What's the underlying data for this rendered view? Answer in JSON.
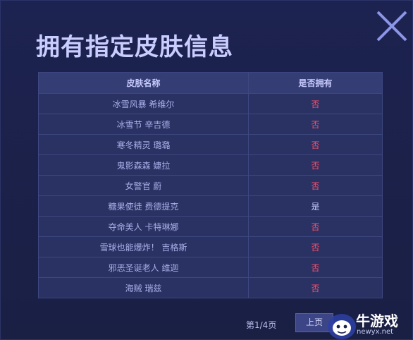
{
  "dialog": {
    "title": "拥有指定皮肤信息",
    "close_icon": "close-icon"
  },
  "table": {
    "headers": [
      "皮肤名称",
      "是否拥有"
    ],
    "rows": [
      {
        "name": "冰雪风暴 希维尔",
        "owned": "否"
      },
      {
        "name": "冰雪节 辛吉德",
        "owned": "否"
      },
      {
        "name": "寒冬精灵 璐璐",
        "owned": "否"
      },
      {
        "name": "鬼影森森 婕拉",
        "owned": "否"
      },
      {
        "name": "女警官 蔚",
        "owned": "否"
      },
      {
        "name": "糖果使徒 费德提克",
        "owned": "是"
      },
      {
        "name": "夺命美人 卡特琳娜",
        "owned": "否"
      },
      {
        "name": "雪球也能爆炸！ 吉格斯",
        "owned": "否"
      },
      {
        "name": "邪恶圣诞老人 维迦",
        "owned": "否"
      },
      {
        "name": "海贼 瑞兹",
        "owned": "否"
      }
    ]
  },
  "pagination": {
    "page_text": "第1/4页",
    "prev_label": "上页"
  },
  "watermark": {
    "brand": "牛游戏",
    "url": "newyx.net"
  }
}
